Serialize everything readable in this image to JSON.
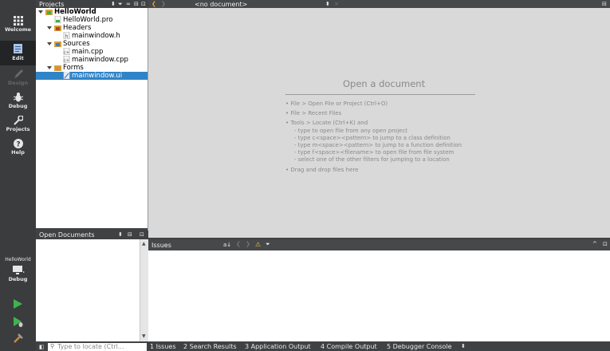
{
  "modes": [
    {
      "label": "Welcome",
      "icon": "grid-icon"
    },
    {
      "label": "Edit",
      "icon": "document-icon"
    },
    {
      "label": "Design",
      "icon": "pencil-icon"
    },
    {
      "label": "Debug",
      "icon": "bug-icon"
    },
    {
      "label": "Projects",
      "icon": "wrench-icon"
    },
    {
      "label": "Help",
      "icon": "help-icon"
    }
  ],
  "kit": {
    "project": "HelloWorld",
    "build": "Debug"
  },
  "project_panel": {
    "title": "Projects"
  },
  "tree": [
    {
      "label": "HelloWorld",
      "level": 0,
      "expanded": true,
      "icon": "project-folder-icon",
      "bold": true
    },
    {
      "label": "HelloWorld.pro",
      "level": 1,
      "icon": "pro-file-icon"
    },
    {
      "label": "Headers",
      "level": 1,
      "expanded": true,
      "icon": "folder-icon"
    },
    {
      "label": "mainwindow.h",
      "level": 2,
      "icon": "header-file-icon"
    },
    {
      "label": "Sources",
      "level": 1,
      "expanded": true,
      "icon": "folder-icon"
    },
    {
      "label": "main.cpp",
      "level": 2,
      "icon": "cpp-file-icon"
    },
    {
      "label": "mainwindow.cpp",
      "level": 2,
      "icon": "cpp-file-icon"
    },
    {
      "label": "Forms",
      "level": 1,
      "expanded": true,
      "icon": "folder-icon"
    },
    {
      "label": "mainwindow.ui",
      "level": 2,
      "icon": "ui-file-icon",
      "selected": true
    }
  ],
  "editor": {
    "doc_selector": "<no document>",
    "heading": "Open a document",
    "hints": [
      "• File > Open File or Project (Ctrl+O)",
      "• File > Recent Files",
      "• Tools > Locate (Ctrl+K) and",
      "- type to open file from any open project",
      "- type c<space><pattern> to jump to a class definition",
      "- type m<space><pattern> to jump to a function definition",
      "- type f<space><filename> to open file from file system",
      "- select one of the other filters for jumping to a location",
      "• Drag and drop files here"
    ]
  },
  "open_documents": {
    "title": "Open Documents"
  },
  "issues": {
    "title": "Issues"
  },
  "locator": {
    "placeholder": "Type to locate (Ctrl..."
  },
  "output_tabs": [
    "1 Issues",
    "2 Search Results",
    "3 Application Output",
    "4 Compile Output",
    "5 Debugger Console"
  ],
  "colors": {
    "selection": "#2f84c8",
    "run": "#3fb34f"
  }
}
